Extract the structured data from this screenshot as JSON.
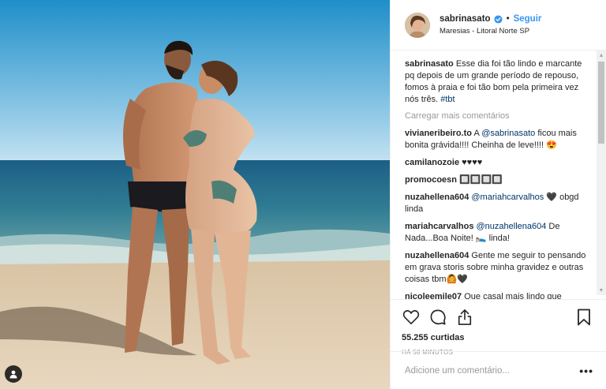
{
  "post": {
    "username": "sabrinasato",
    "follow_label": "Seguir",
    "separator": "•",
    "location": "Maresias - Litoral Norte SP",
    "caption_username": "sabrinasato",
    "caption_text": "Esse dia foi tão lindo e marcante pq depois de um grande período de repouso, fomos à praia e foi tão bom pela primeira vez nós três.",
    "caption_hashtag": "#tbt",
    "load_more_label": "Carregar mais comentários",
    "comments": [
      {
        "user": "vivianeribeiro.to",
        "pre": "A ",
        "mention": "@sabrinasato",
        "text": " ficou mais bonita grávida!!!! Cheinha de leve!!!! 😍"
      },
      {
        "user": "camilanozoie",
        "pre": "",
        "mention": "",
        "text": "♥♥♥♥"
      },
      {
        "user": "promocoesn",
        "pre": "",
        "mention": "",
        "text": "🔲🔲🔲🔲"
      },
      {
        "user": "nuzahellena604",
        "pre": "",
        "mention": "@mariahcarvalhos",
        "text": " 🖤 obgd linda"
      },
      {
        "user": "mariahcarvalhos",
        "pre": "",
        "mention": "@nuzahellena604",
        "text": " De Nada...Boa Noite! 🛌 linda!"
      },
      {
        "user": "nuzahellena604",
        "pre": "",
        "mention": "",
        "text": "Gente me seguir to pensando em grava storis sobre minha gravidez e outras coisas tbm🙆🖤"
      },
      {
        "user": "nicoleemile07",
        "pre": "",
        "mention": "",
        "text": "Que casal mais lindo que"
      }
    ],
    "likes": "55.255 curtidas",
    "time": "HÁ 58 MINUTOS",
    "add_comment_placeholder": "Adicione um comentário...",
    "more_label": "•••"
  },
  "icons": {
    "verified": "verified-badge-icon",
    "like": "heart-icon",
    "comment": "comment-bubble-icon",
    "share": "share-icon",
    "save": "bookmark-icon",
    "tag": "user-tag-icon"
  },
  "colors": {
    "link_blue": "#3897f0",
    "mention": "#003569",
    "muted": "#999999",
    "text": "#262626"
  }
}
